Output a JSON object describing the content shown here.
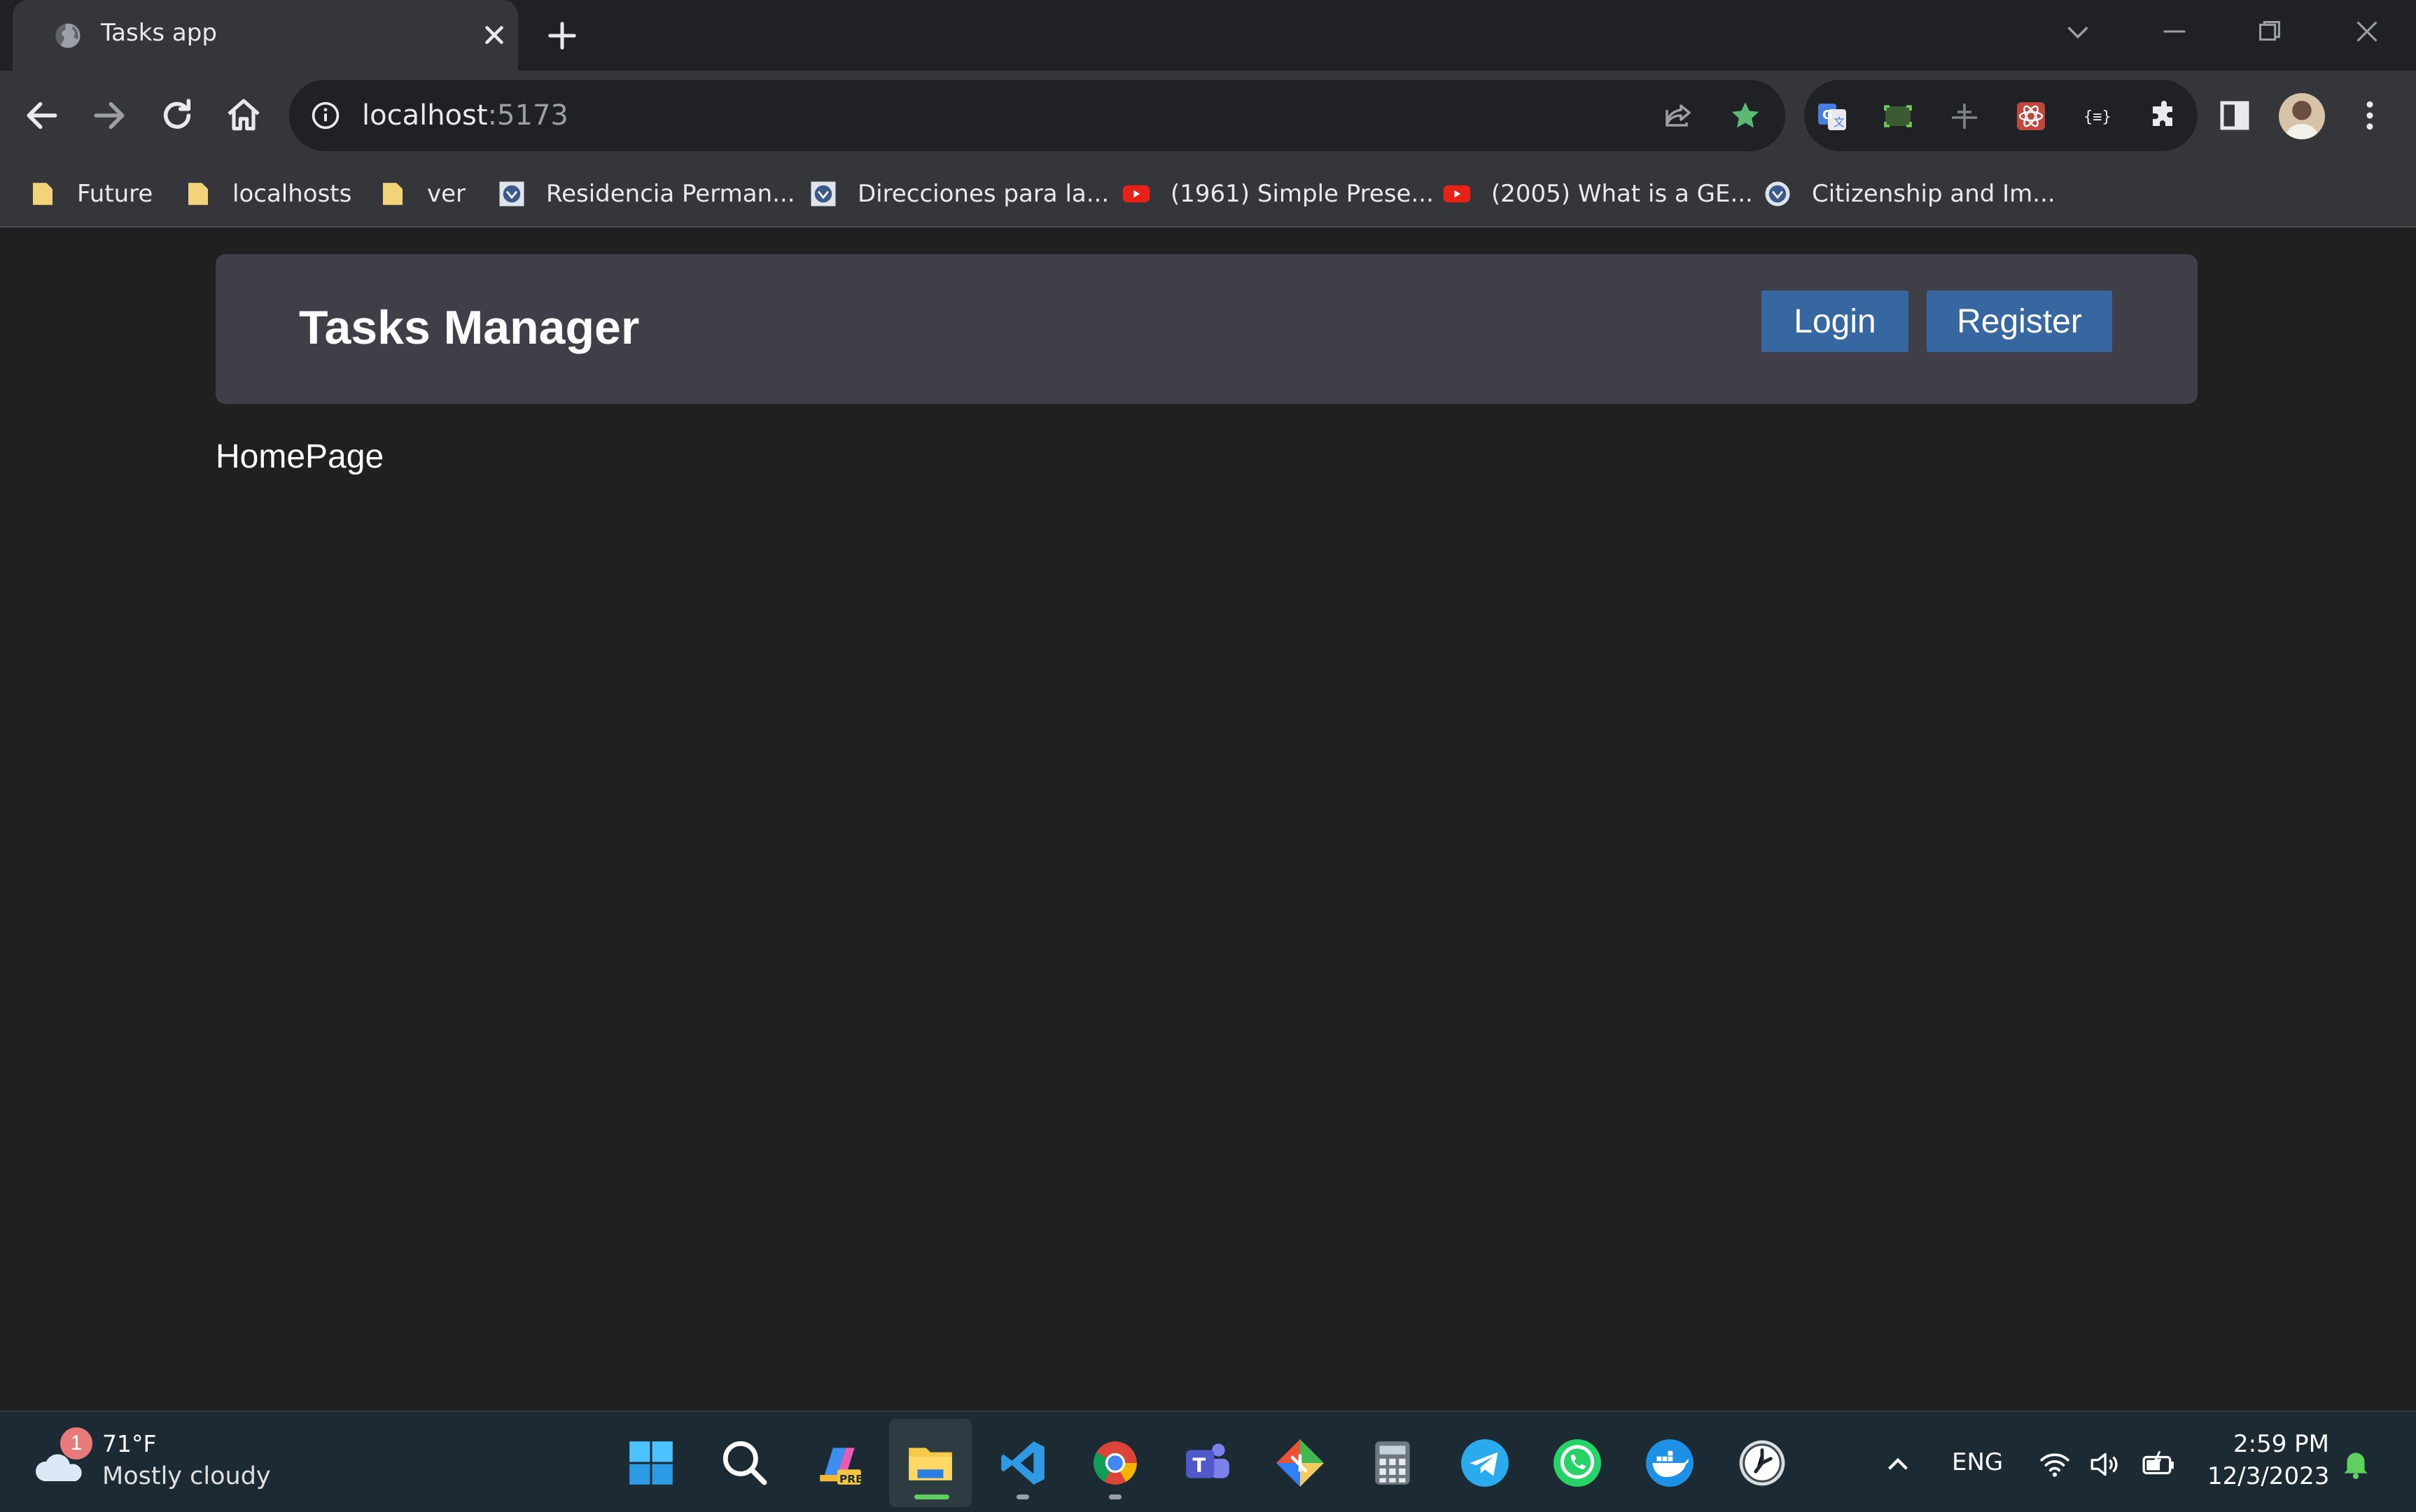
{
  "browser": {
    "tab": {
      "title": "Tasks app",
      "favicon": "globe-icon"
    },
    "address": {
      "host": "localhost",
      "port": ":5173"
    },
    "bookmarks": [
      {
        "label": "Future",
        "icon": "folder-icon"
      },
      {
        "label": "localhosts",
        "icon": "folder-icon"
      },
      {
        "label": "ver",
        "icon": "folder-icon"
      },
      {
        "label": "Residencia Perman...",
        "icon": "dhs-seal-icon"
      },
      {
        "label": "Direcciones para la...",
        "icon": "dhs-seal-icon"
      },
      {
        "label": "(1961) Simple Prese...",
        "icon": "youtube-icon"
      },
      {
        "label": "(2005) What is a GE...",
        "icon": "youtube-icon"
      },
      {
        "label": "Citizenship and Im...",
        "icon": "dhs-seal-icon"
      }
    ],
    "colors": {
      "bookmark_star": "#5bb974",
      "accent": "#3767a0"
    }
  },
  "app": {
    "brand": "Tasks Manager",
    "login_label": "Login",
    "register_label": "Register",
    "page_text": "HomePage",
    "colors": {
      "navbar_bg": "#403f47",
      "button_bg": "#3767a0",
      "page_bg": "#202020"
    }
  },
  "taskbar": {
    "weather": {
      "badge": "1",
      "temp": "71°F",
      "desc": "Mostly cloudy"
    },
    "apps": [
      "windows-start-icon",
      "search-icon",
      "copilot-icon",
      "file-explorer-icon",
      "vscode-icon",
      "chrome-icon",
      "teams-icon",
      "git-icon",
      "calculator-icon",
      "telegram-icon",
      "whatsapp-icon",
      "docker-icon",
      "clock-icon"
    ],
    "language": "ENG",
    "time": "2:59 PM",
    "date": "12/3/2023"
  }
}
